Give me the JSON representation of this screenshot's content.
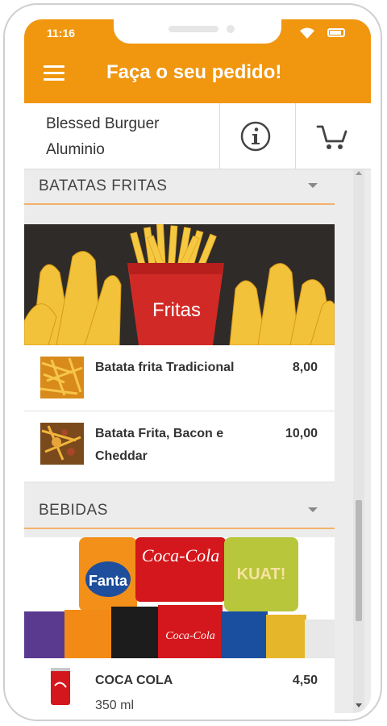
{
  "status_bar": {
    "time": "11:16",
    "wifi_icon": "wifi-icon",
    "battery_icon": "battery-icon"
  },
  "app_bar": {
    "title": "Faça o seu pedido!",
    "menu_icon": "hamburger-menu-icon",
    "color": "#f0960f"
  },
  "store": {
    "name": "Blessed Burguer Aluminio",
    "info_icon": "info-icon",
    "cart_icon": "cart-icon"
  },
  "sections": [
    {
      "title": "BATATAS FRITAS",
      "banner_text": "Fritas",
      "items": [
        {
          "name": "Batata frita Tradicional",
          "price": "8,00"
        },
        {
          "name": "Batata Frita, Bacon e Cheddar",
          "price": "10,00"
        }
      ]
    },
    {
      "title": "BEBIDAS",
      "banner_labels": [
        "Fanta",
        "Coca-Cola",
        "KUAT!",
        "Coca-Cola"
      ],
      "items": [
        {
          "name": "COCA COLA",
          "price": "4,50",
          "description": "350 ml"
        }
      ]
    }
  ],
  "colors": {
    "accent": "#f0960f",
    "section_line": "#f3b26a",
    "background": "#ececec"
  }
}
